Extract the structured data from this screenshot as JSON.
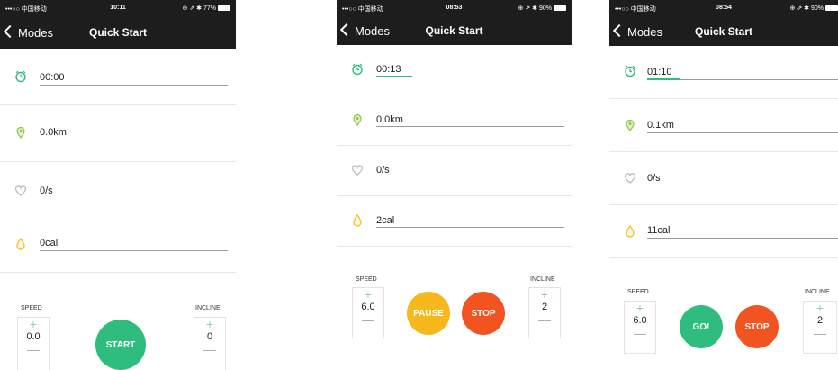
{
  "colors": {
    "nav_bg": "#1d1d1d",
    "accent_green": "#2ebd7e",
    "stop_orange": "#f25421",
    "pause_yellow": "#f6b81c"
  },
  "screens": [
    {
      "status": {
        "carrier": "•••○○ 中国移动 ",
        "time": "10:11",
        "right": "⊕ ⇗ ✱ 77%"
      },
      "nav": {
        "back": "Modes",
        "title": "Quick Start"
      },
      "time": "00:00",
      "distance": "0.0km",
      "pulse": "0/s",
      "calories": "0cal",
      "time_progress": 0,
      "speed": {
        "label": "SPEED",
        "value": "0.0"
      },
      "incline": {
        "label": "INCLINE",
        "value": "0"
      },
      "buttons": {
        "start": "START"
      }
    },
    {
      "status": {
        "carrier": "•••○○ 中国移动 ",
        "time": "08:53",
        "right": "⊕ ⇗ ✱ 90%"
      },
      "nav": {
        "back": "Modes",
        "title": "Quick Start"
      },
      "time": "00:13",
      "distance": "0.0km",
      "pulse": "0/s",
      "calories": "2cal",
      "time_progress": 0.19,
      "speed": {
        "label": "SPEED",
        "value": "6.0"
      },
      "incline": {
        "label": "INCLINE",
        "value": "2"
      },
      "buttons": {
        "pause": "PAUSE",
        "stop": "STOP"
      }
    },
    {
      "status": {
        "carrier": "•••○○ 中国移动 ",
        "time": "08:54",
        "right": "⊕ ⇗ ✱ 90%"
      },
      "nav": {
        "back": "Modes",
        "title": "Quick Start"
      },
      "time": "01:10",
      "distance": "0.1km",
      "pulse": "0/s",
      "calories": "11cal",
      "time_progress": 0.17,
      "speed": {
        "label": "SPEED",
        "value": "6.0"
      },
      "incline": {
        "label": "INCLINE",
        "value": "2"
      },
      "buttons": {
        "go": "GO!",
        "stop": "STOP"
      }
    }
  ]
}
